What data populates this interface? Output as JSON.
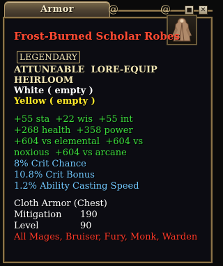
{
  "window": {
    "title": "Armor",
    "pin_glyph": "◼",
    "close_glyph": "✕",
    "swirl_glyph": "@"
  },
  "item": {
    "name": "Frost-Burned Scholar Robes",
    "icon": "robe-icon",
    "tier": "LEGENDARY",
    "flags_line1": "ATTUNEABLE  LORE-EQUIP",
    "flags_line2": "HEIRLOOM",
    "adornment_white": "White ( empty )",
    "adornment_yellow": "Yellow ( empty )",
    "stats": [
      "+55 sta  +22 wis  +55 int",
      "+268 health  +358 power",
      "+604 vs elemental  +604 vs",
      "noxious  +604 vs arcane"
    ],
    "secondary_stats": [
      "8% Crit Chance",
      "10.8% Crit Bonus",
      "1.2% Ability Casting Speed"
    ],
    "armor_type": "Cloth Armor (Chest)",
    "mitigation_label": "Mitigation",
    "mitigation_value": "190",
    "level_label": "Level",
    "level_value": "90",
    "classes": "All Mages, Bruiser, Fury, Monk, Warden"
  },
  "colors": {
    "name": "#ff4a32",
    "flags": "#f2e6b4",
    "stats": "#3cdc3c",
    "secondary": "#72c8ff",
    "classes": "#ff3a2a",
    "panel_border": "#8c7448"
  }
}
